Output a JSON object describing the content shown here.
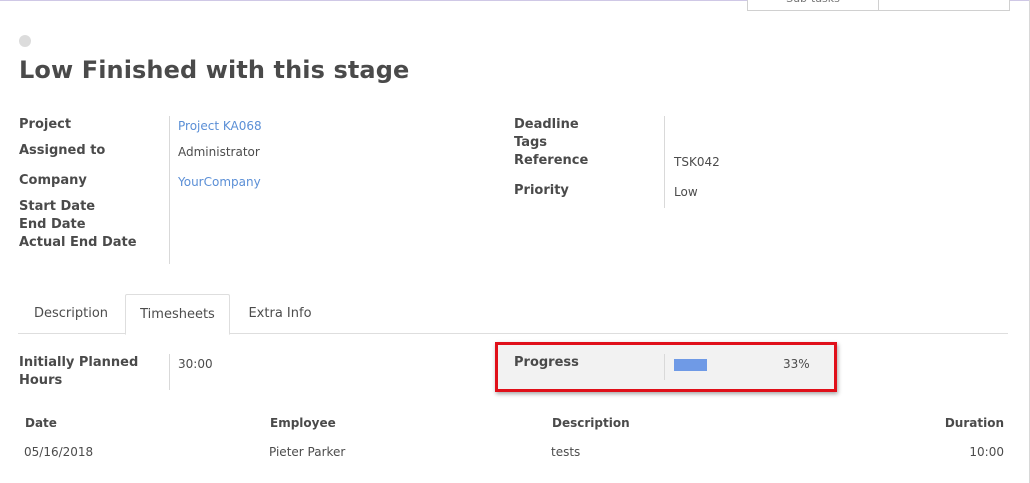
{
  "topbar": {
    "subtasks_label": "Sub-tasks"
  },
  "task": {
    "title": "Low Finished with this stage"
  },
  "fields_left": {
    "project_label": "Project",
    "project_value": "Project KA068",
    "assigned_label": "Assigned to",
    "assigned_value": "Administrator",
    "company_label": "Company",
    "company_value": "YourCompany",
    "start_label": "Start Date",
    "end_label": "End Date",
    "actual_end_label": "Actual End Date"
  },
  "fields_right": {
    "deadline_label": "Deadline",
    "tags_label": "Tags",
    "reference_label": "Reference",
    "reference_value": "TSK042",
    "priority_label": "Priority",
    "priority_value": "Low"
  },
  "tabs": [
    {
      "label": "Description",
      "active": false
    },
    {
      "label": "Timesheets",
      "active": true
    },
    {
      "label": "Extra Info",
      "active": false
    }
  ],
  "timesheets": {
    "planned_label_line1": "Initially Planned",
    "planned_label_line2": "Hours",
    "planned_value": "30:00",
    "progress_label": "Progress",
    "progress_text": "33%",
    "progress_fraction": 0.33,
    "progress_color": "#6f9ae6",
    "highlight_color": "#e0101a",
    "table": {
      "headers": [
        "Date",
        "Employee",
        "Description",
        "Duration"
      ],
      "rows": [
        [
          "05/16/2018",
          "Pieter Parker",
          "tests",
          "10:00"
        ]
      ]
    }
  }
}
